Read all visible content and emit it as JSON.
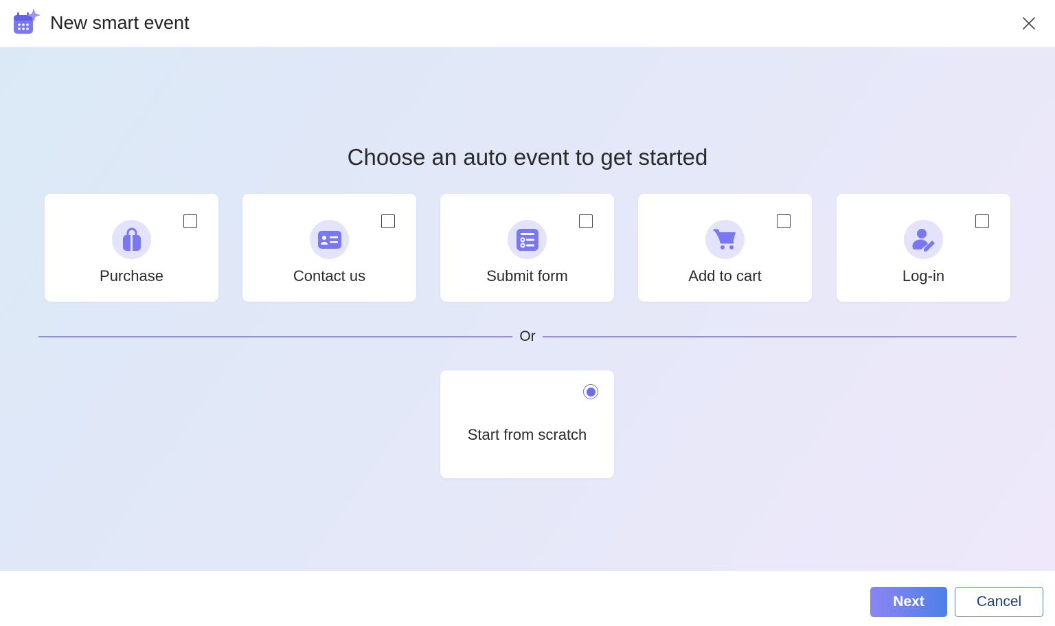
{
  "window": {
    "title": "New smart event",
    "app_icon": "calendar-sparkle-icon",
    "close_icon": "close-icon"
  },
  "main": {
    "heading": "Choose an auto event to get started",
    "cards": [
      {
        "label": "Purchase",
        "icon": "shopping-bag-icon",
        "checked": false
      },
      {
        "label": "Contact us",
        "icon": "contact-card-icon",
        "checked": false
      },
      {
        "label": "Submit form",
        "icon": "form-list-icon",
        "checked": false
      },
      {
        "label": "Add to cart",
        "icon": "cart-icon",
        "checked": false
      },
      {
        "label": "Log-in",
        "icon": "person-edit-icon",
        "checked": false
      }
    ],
    "separator_text": "Or",
    "scratch_card": {
      "label": "Start from scratch",
      "selected": true
    }
  },
  "footer": {
    "next_label": "Next",
    "cancel_label": "Cancel"
  },
  "colors": {
    "accent": "#6c6ef0",
    "icon_bg": "#e3e4fb",
    "icon_fg": "#7a77f3",
    "divider": "#8e8cf0",
    "cancel_text": "#1f3f86"
  }
}
